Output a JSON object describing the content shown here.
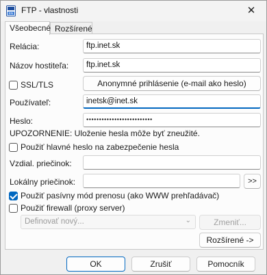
{
  "window": {
    "title": "FTP - vlastnosti",
    "close_glyph": "✕"
  },
  "tabs": [
    {
      "label": "Všeobecné",
      "active": true
    },
    {
      "label": "Rozšírené",
      "active": false
    }
  ],
  "fields": {
    "relacia": {
      "label": "Relácia:",
      "value": "ftp.inet.sk"
    },
    "hostitel": {
      "label": "Názov hostiteľa:",
      "value": "ftp.inet.sk"
    },
    "ssl": {
      "label": "SSL/TLS",
      "checked": false
    },
    "anon_button": "Anonymné prihlásenie (e-mail ako heslo)",
    "user": {
      "label": "Používateľ:",
      "value": "inetsk@inet.sk"
    },
    "password": {
      "label": "Heslo:",
      "value": "●●●●●●●●●●●●●●●●●●●●●●●●●●"
    },
    "warning": "UPOZORNENIE: Uloženie hesla môže byť zneužité.",
    "master_password": {
      "label": "Použiť hlavné heslo na zabezpečenie hesla",
      "checked": false
    },
    "remote_dir": {
      "label": "Vzdial. priečinok:",
      "value": ""
    },
    "local_dir": {
      "label": "Lokálny priečinok:",
      "value": "",
      "browse": ">>"
    },
    "passive": {
      "label": "Použiť pasívny mód prenosu (ako WWW prehľadávač)",
      "checked": true
    },
    "firewall": {
      "label": "Použiť firewall (proxy server)",
      "checked": false
    },
    "firewall_select": {
      "value": "Definovať nový...",
      "arrow": "⌄"
    },
    "change_button": "Zmeniť...",
    "advanced_button": "Rozšírené ->"
  },
  "footer": {
    "ok": "OK",
    "cancel": "Zrušiť",
    "help": "Pomocník"
  },
  "colors": {
    "accent": "#0067c0"
  }
}
